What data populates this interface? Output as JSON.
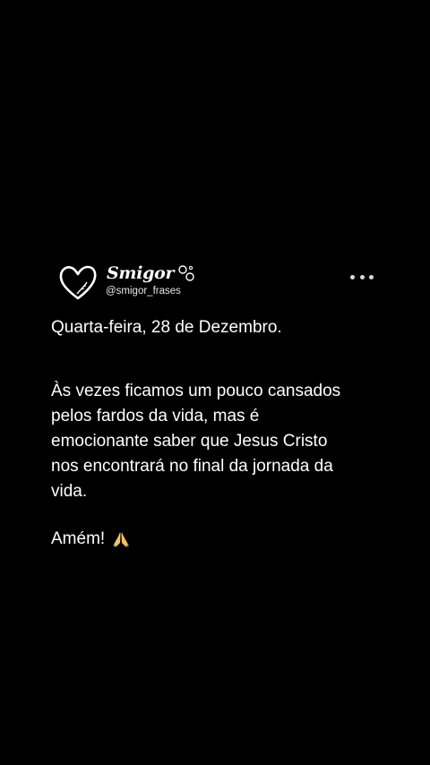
{
  "post": {
    "author": {
      "display_name": "Smigor",
      "handle": "@smigor_frases",
      "avatar_icon": "heart-logo-icon",
      "badge_icon": "infinity-circles-icon"
    },
    "menu_icon": "more-options-icon",
    "date_line": "Quarta-feira, 28 de Dezembro.",
    "body_lines": [
      "Às vezes ficamos um pouco cansados",
      "pelos fardos da vida, mas é",
      "emocionante saber que Jesus Cristo",
      "nos encontrará no final da jornada da",
      "vida."
    ],
    "closing": "Amém!",
    "closing_emoji_icon": "praying-hands-icon"
  },
  "colors": {
    "background": "#000000",
    "text": "#ffffff",
    "muted": "#e8e8e8"
  }
}
